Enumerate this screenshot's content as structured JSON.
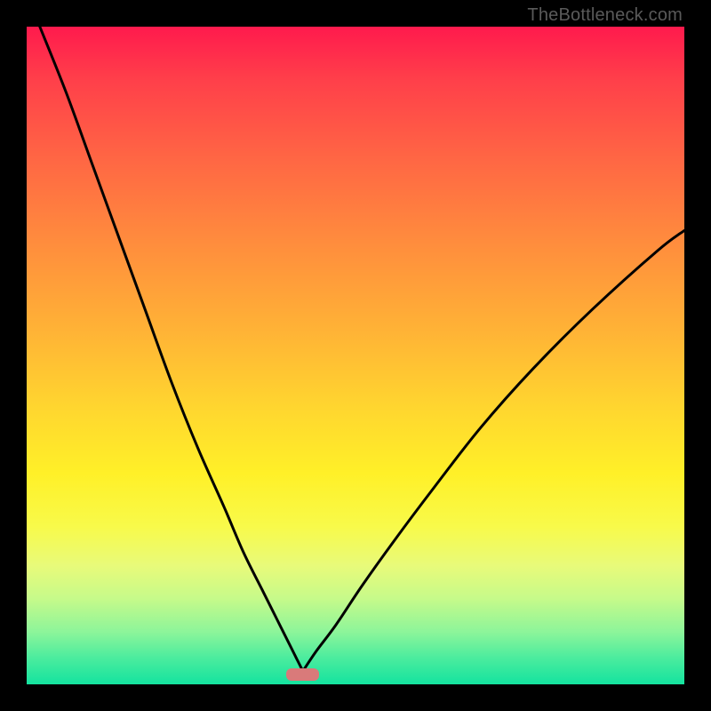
{
  "watermark": "TheBottleneck.com",
  "colors": {
    "frame": "#000000",
    "curve": "#000000",
    "marker": "#d97a7a",
    "gradient_stops": [
      "#ff1a4d",
      "#ff6644",
      "#ffd62f",
      "#fff028",
      "#14e39f"
    ]
  },
  "chart_data": {
    "type": "line",
    "title": "",
    "xlabel": "",
    "ylabel": "",
    "xlim": [
      0,
      100
    ],
    "ylim": [
      0,
      100
    ],
    "notes": "Background is a vertical red→orange→yellow→green gradient. Two black curves descend from the top edges toward a minimum near x≈42, y≈2, forming a V / cusp. A small rounded salmon marker sits at the bottom near the minimum.",
    "series": [
      {
        "name": "left_branch",
        "x": [
          2,
          6,
          10,
          14,
          18,
          22,
          26,
          30,
          33,
          36,
          38,
          40,
          41,
          42
        ],
        "y": [
          100,
          90,
          79,
          68,
          57,
          46,
          36,
          27,
          20,
          14,
          10,
          6,
          4,
          2
        ]
      },
      {
        "name": "right_branch",
        "x": [
          42,
          44,
          47,
          51,
          56,
          62,
          69,
          77,
          86,
          96,
          100
        ],
        "y": [
          2,
          5,
          9,
          15,
          22,
          30,
          39,
          48,
          57,
          66,
          69
        ]
      }
    ],
    "marker": {
      "x_center": 42,
      "width": 5,
      "y": 1.5,
      "height": 1.8
    }
  }
}
